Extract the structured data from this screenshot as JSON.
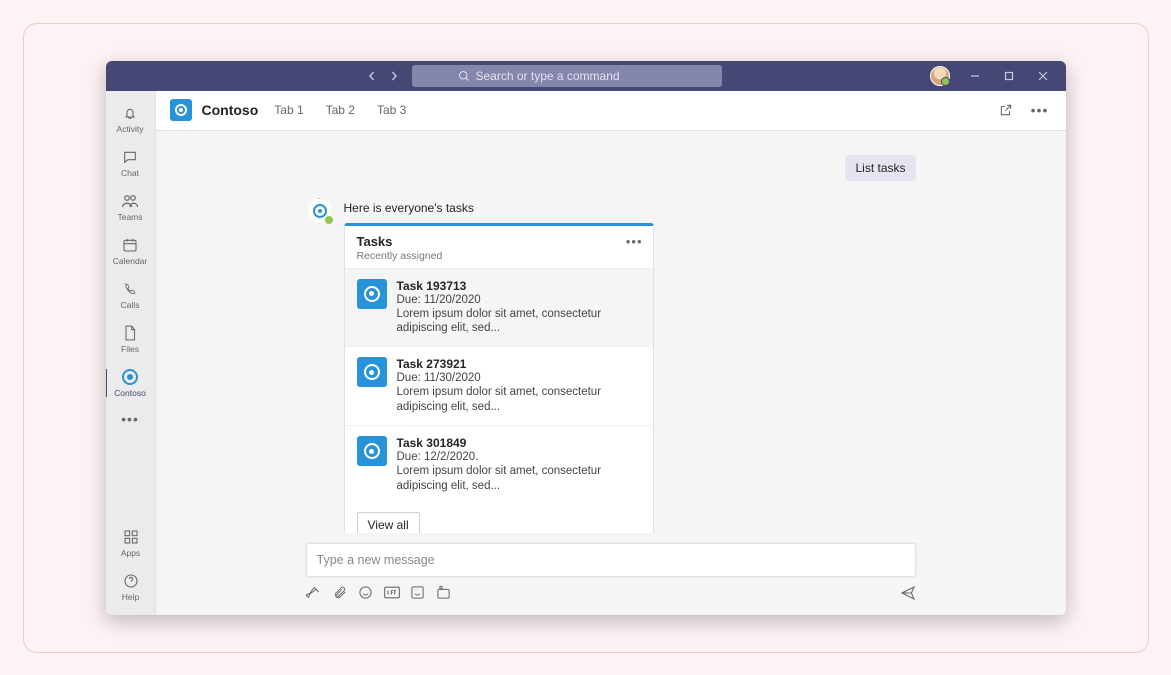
{
  "titlebar": {
    "search_placeholder": "Search or type a command"
  },
  "rail": {
    "items": [
      {
        "label": "Activity"
      },
      {
        "label": "Chat"
      },
      {
        "label": "Teams"
      },
      {
        "label": "Calendar"
      },
      {
        "label": "Calls"
      },
      {
        "label": "Files"
      },
      {
        "label": "Contoso"
      }
    ],
    "bottom": [
      {
        "label": "Apps"
      },
      {
        "label": "Help"
      }
    ]
  },
  "header": {
    "app_name": "Contoso",
    "tabs": [
      "Tab 1",
      "Tab 2",
      "Tab 3"
    ]
  },
  "chat": {
    "user_message": "List tasks",
    "bot_line": "Here is everyone's tasks",
    "card": {
      "title": "Tasks",
      "subtitle": "Recently assigned",
      "tasks": [
        {
          "title": "Task 193713",
          "due": "Due: 11/20/2020",
          "desc": "Lorem ipsum dolor sit amet, consectetur adipiscing elit, sed..."
        },
        {
          "title": "Task 273921",
          "due": "Due: 11/30/2020",
          "desc": "Lorem ipsum dolor sit amet, consectetur adipiscing elit, sed..."
        },
        {
          "title": "Task 301849",
          "due": "Due: 12/2/2020.",
          "desc": "Lorem ipsum dolor sit amet, consectetur adipiscing elit, sed..."
        }
      ],
      "view_all": "View all"
    }
  },
  "composer": {
    "placeholder": "Type a new message"
  }
}
